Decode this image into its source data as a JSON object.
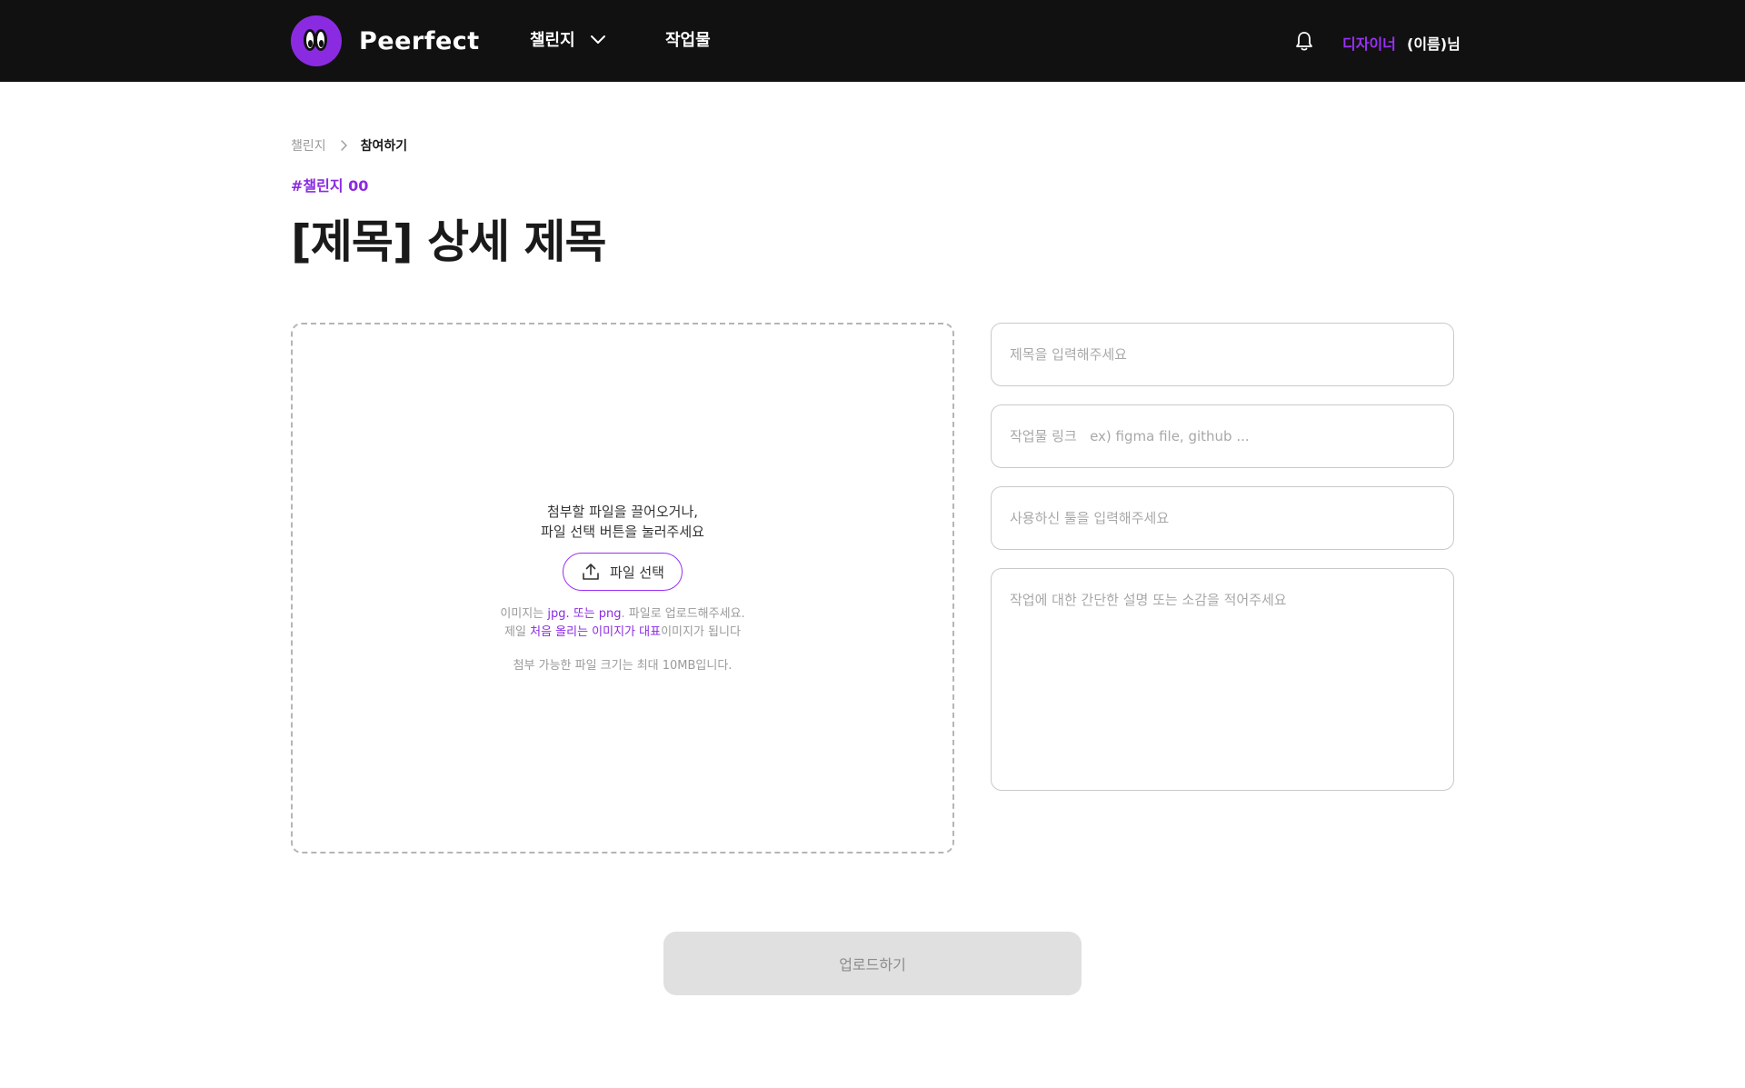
{
  "header": {
    "logo_text": "Peerfect",
    "nav": {
      "challenge": "챌린지",
      "works": "작업물"
    },
    "user": {
      "role": "디자이너",
      "name": "(이름)님"
    }
  },
  "breadcrumb": {
    "parent": "챌린지",
    "current": "참여하기"
  },
  "tag": "#챌린지 00",
  "title": "[제목] 상세 제목",
  "dropzone": {
    "line1": "첨부할 파일을 끌어오거나,",
    "line2": "파일 선택 버튼을 눌러주세요",
    "button_label": "파일 선택",
    "note1_prefix": "이미지는 ",
    "note1_highlight": "jpg. 또는 png",
    "note1_suffix": ". 파일로 업로드해주세요.",
    "note2_prefix": "제일 ",
    "note2_highlight": "처음 올리는 이미지가 대표",
    "note2_suffix": "이미지가 됩니다",
    "size_note": "첨부 가능한 파일 크기는 최대 10MB입니다."
  },
  "form": {
    "title_placeholder": "제목을 입력해주세요",
    "link_placeholder": "작업물 링크   ex) figma file, github ...",
    "tools_placeholder": "사용하신 툴을 입력해주세요",
    "description_placeholder": "작업에 대한 간단한 설명 또는 소감을 적어주세요"
  },
  "submit_label": "업로드하기",
  "colors": {
    "accent": "#8a2be2",
    "header_bg": "#111111",
    "disabled_bg": "#e0e0e0"
  },
  "icons": [
    "logo-icon",
    "chevron-down-icon",
    "bell-icon",
    "chevron-right-icon",
    "upload-icon"
  ]
}
